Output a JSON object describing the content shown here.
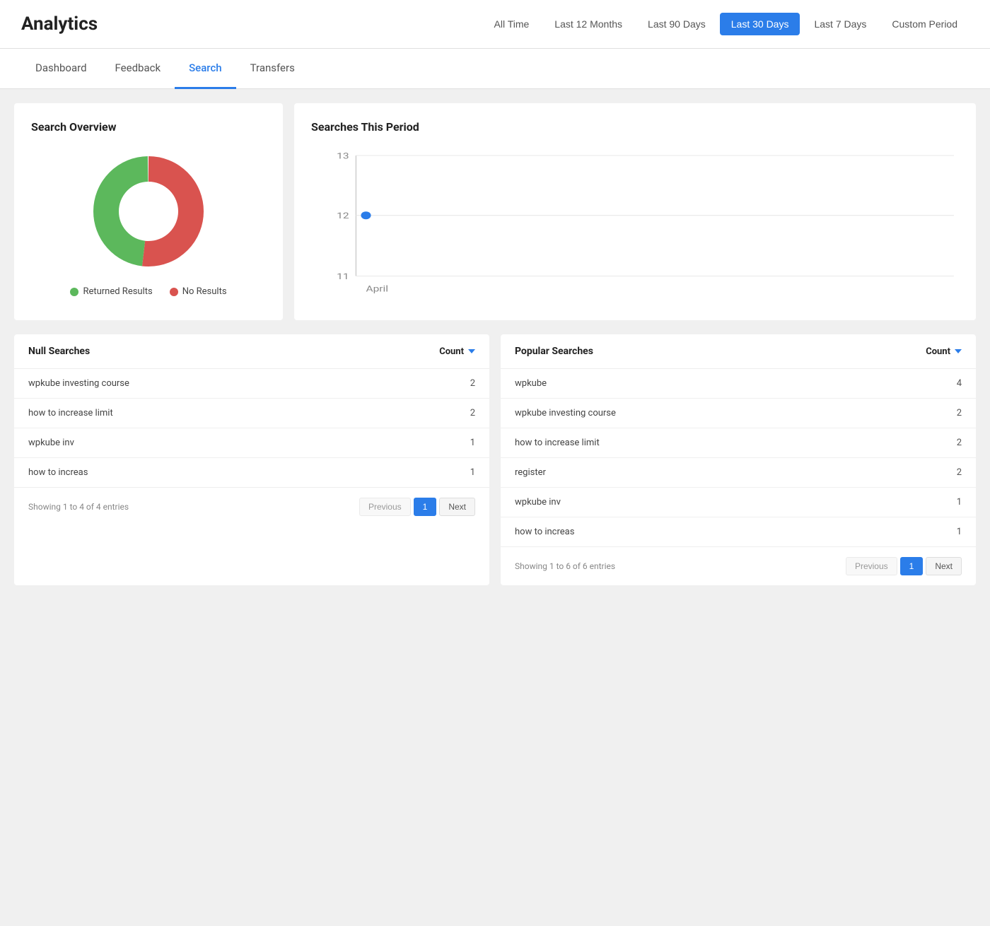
{
  "header": {
    "title": "Analytics",
    "period_buttons": [
      {
        "label": "All Time",
        "active": false
      },
      {
        "label": "Last 12 Months",
        "active": false
      },
      {
        "label": "Last 90 Days",
        "active": false
      },
      {
        "label": "Last 30 Days",
        "active": true
      },
      {
        "label": "Last 7 Days",
        "active": false
      },
      {
        "label": "Custom Period",
        "active": false
      }
    ]
  },
  "tabs": [
    {
      "label": "Dashboard",
      "active": false
    },
    {
      "label": "Feedback",
      "active": false
    },
    {
      "label": "Search",
      "active": true
    },
    {
      "label": "Transfers",
      "active": false
    }
  ],
  "search_overview": {
    "title": "Search Overview",
    "donut": {
      "returned_results_pct": 48,
      "no_results_pct": 52,
      "colors": {
        "returned": "#5cb85c",
        "no_results": "#d9534f"
      }
    },
    "legend": [
      {
        "label": "Returned Results",
        "color": "#5cb85c"
      },
      {
        "label": "No Results",
        "color": "#d9534f"
      }
    ]
  },
  "searches_this_period": {
    "title": "Searches This Period",
    "y_labels": [
      13,
      12,
      11
    ],
    "x_label": "April",
    "data_point": {
      "x": 0,
      "y": 12
    },
    "y_min": 11,
    "y_max": 13,
    "dot_color": "#2b7de9"
  },
  "null_searches": {
    "title": "Null Searches",
    "count_label": "Count",
    "rows": [
      {
        "term": "wpkube investing course",
        "count": 2
      },
      {
        "term": "how to increase limit",
        "count": 2
      },
      {
        "term": "wpkube inv",
        "count": 1
      },
      {
        "term": "how to increas",
        "count": 1
      }
    ],
    "pagination": {
      "showing": "Showing 1 to 4 of 4 entries",
      "prev_label": "Previous",
      "page": "1",
      "next_label": "Next"
    }
  },
  "popular_searches": {
    "title": "Popular Searches",
    "count_label": "Count",
    "rows": [
      {
        "term": "wpkube",
        "count": 4
      },
      {
        "term": "wpkube investing course",
        "count": 2
      },
      {
        "term": "how to increase limit",
        "count": 2
      },
      {
        "term": "register",
        "count": 2
      },
      {
        "term": "wpkube inv",
        "count": 1
      },
      {
        "term": "how to increas",
        "count": 1
      }
    ],
    "pagination": {
      "showing": "Showing 1 to 6 of 6 entries",
      "prev_label": "Previous",
      "page": "1",
      "next_label": "Next"
    }
  }
}
